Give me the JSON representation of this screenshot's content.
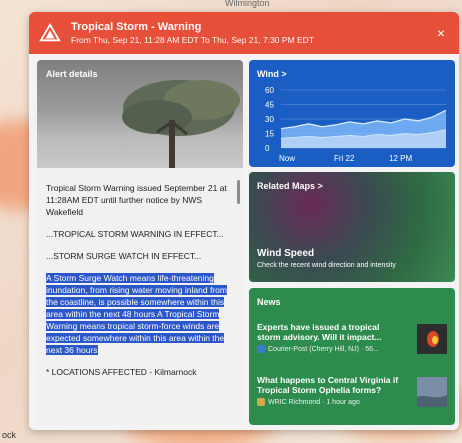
{
  "map": {
    "city": "Wilmington",
    "corner_label": "ock"
  },
  "header": {
    "title": "Tropical Storm - Warning",
    "subtitle": "From Thu, Sep 21, 11:28 AM EDT To Thu, Sep 21, 7:30 PM EDT",
    "close": "×"
  },
  "alert": {
    "label": "Alert details",
    "paragraphs": [
      "Tropical Storm Warning issued September 21 at 11:28AM EDT until further notice by NWS Wakefield",
      "...TROPICAL STORM WARNING IN EFFECT...",
      "...STORM SURGE WATCH IN EFFECT..."
    ],
    "highlighted": "A Storm Surge Watch means life-threatening inundation, from rising water moving inland from the coastline, is possible somewhere within this area within the next 48 hours A Tropical Storm Warning means tropical storm-force winds are expected somewhere within this area within the next 36 hours",
    "footer": "* LOCATIONS AFFECTED - Kilmarnock"
  },
  "wind": {
    "title": "Wind >",
    "y_ticks": [
      "60",
      "45",
      "30",
      "15",
      "0"
    ],
    "x_labels": [
      "Now",
      "Fri 22",
      "12 PM"
    ]
  },
  "chart_data": {
    "type": "area",
    "title": "Wind",
    "ylim": [
      0,
      60
    ],
    "y_ticks": [
      0,
      15,
      30,
      45,
      60
    ],
    "x": [
      "Now",
      "",
      "",
      "",
      "Fri 22",
      "",
      "",
      "",
      "12 PM",
      "",
      "",
      "",
      ""
    ],
    "series": [
      {
        "values": [
          20,
          22,
          25,
          22,
          24,
          27,
          25,
          28,
          26,
          30,
          28,
          32,
          39
        ]
      },
      {
        "values": [
          10,
          11,
          12,
          11,
          12,
          13,
          12,
          14,
          13,
          15,
          14,
          16,
          19
        ]
      }
    ]
  },
  "maps": {
    "title": "Related Maps >",
    "heading": "Wind Speed",
    "description": "Check the recent wind direction and intensity"
  },
  "news": {
    "title": "News",
    "items": [
      {
        "title": "Experts have issued a tropical storm advisory. Will it impact...",
        "source": "Courier-Post (Cherry Hill, NJ) · 56..."
      },
      {
        "title": "What happens to Central Virginia if Tropical Storm Ophelia forms?",
        "source": "WRIC Richmond · 1 hour ago"
      }
    ]
  },
  "colors": {
    "header": "#e6503a",
    "wind_card": "#1a5ec4",
    "news_card": "#2e8b4e",
    "highlight": "#2b57c9"
  }
}
